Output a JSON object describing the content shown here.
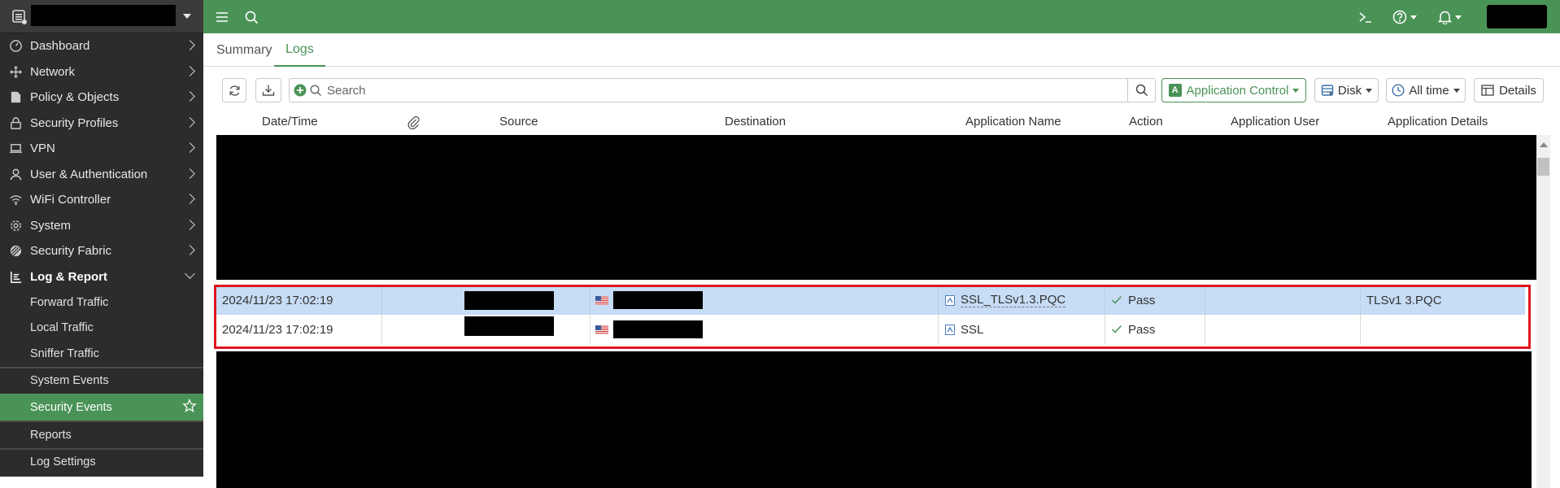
{
  "topbar": {
    "menu_icon": "hamburger-icon",
    "search_icon": "search-icon",
    "cli_icon": "terminal-icon",
    "help_icon": "help-icon",
    "notifications_icon": "bell-icon"
  },
  "sidebar": {
    "items": [
      {
        "label": "Dashboard",
        "icon": "dashboard-icon"
      },
      {
        "label": "Network",
        "icon": "network-icon"
      },
      {
        "label": "Policy & Objects",
        "icon": "policy-icon"
      },
      {
        "label": "Security Profiles",
        "icon": "lock-icon"
      },
      {
        "label": "VPN",
        "icon": "laptop-icon"
      },
      {
        "label": "User & Authentication",
        "icon": "user-icon"
      },
      {
        "label": "WiFi Controller",
        "icon": "wifi-icon"
      },
      {
        "label": "System",
        "icon": "gear-icon"
      },
      {
        "label": "Security Fabric",
        "icon": "fabric-icon"
      },
      {
        "label": "Log & Report",
        "icon": "report-icon"
      }
    ],
    "sub_items": [
      {
        "label": "Forward Traffic"
      },
      {
        "label": "Local Traffic"
      },
      {
        "label": "Sniffer Traffic"
      },
      {
        "label": "System Events"
      },
      {
        "label": "Security Events"
      },
      {
        "label": "Reports"
      },
      {
        "label": "Log Settings"
      }
    ]
  },
  "tabs": [
    {
      "label": "Summary"
    },
    {
      "label": "Logs"
    }
  ],
  "toolbar": {
    "search_placeholder": "Search",
    "log_type": "Application Control",
    "log_type_badge": "A",
    "source": "Disk",
    "time_range": "All time",
    "details": "Details"
  },
  "table": {
    "columns": [
      "Date/Time",
      "Source",
      "Destination",
      "Application Name",
      "Action",
      "Application User",
      "Application Details"
    ],
    "rows": [
      {
        "datetime": "2024/11/23 17:02:19",
        "app_name": "SSL_TLSv1.3.PQC",
        "action": "Pass",
        "app_user": "",
        "app_details": "TLSv1 3.PQC"
      },
      {
        "datetime": "2024/11/23 17:02:19",
        "app_name": "SSL",
        "action": "Pass",
        "app_user": "",
        "app_details": ""
      }
    ]
  },
  "colors": {
    "brand_green": "#4a9357",
    "sidebar_bg": "#2c2c2c",
    "selected_row": "#c7dcf5",
    "highlight_red": "#e0161e"
  }
}
